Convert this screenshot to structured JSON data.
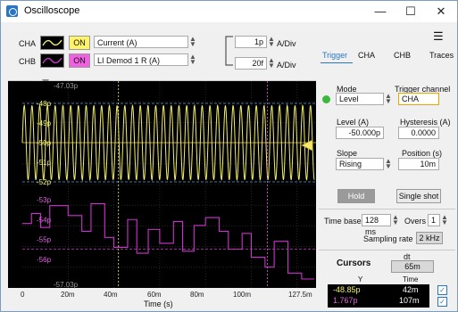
{
  "window": {
    "title": "Oscilloscope",
    "minimize": "—",
    "maximize": "☐",
    "close": "✕"
  },
  "channels": [
    {
      "label": "CHA",
      "on": "ON",
      "signal": "Current (A)",
      "color": "#f2ef6a",
      "on_color": "#fff36a"
    },
    {
      "label": "CHB",
      "on": "ON",
      "signal": "LI Demod 1 R (A)",
      "color": "#cc33cc",
      "on_color": "#f060e0"
    }
  ],
  "scale": [
    {
      "value": "1p",
      "unit": "A/Div"
    },
    {
      "value": "20f",
      "unit": "A/Div"
    }
  ],
  "plot": {
    "cha_labels": [
      "48p",
      "49p",
      "50p",
      "51p",
      "52p"
    ],
    "chb_labels": [
      "53p",
      "54p",
      "55p",
      "56p"
    ],
    "top_label": "-47.03p",
    "bottom_label": "-57.03p"
  },
  "xaxis": {
    "ticks": [
      "0",
      "20m",
      "40m",
      "60m",
      "80m",
      "100m",
      "127.5m"
    ],
    "label": "Time (s)"
  },
  "tabs": [
    "Trigger",
    "CHA",
    "CHB",
    "Traces"
  ],
  "trigger": {
    "mode_label": "Mode",
    "mode_value": "Level",
    "channel_label": "Trigger channel",
    "channel_value": "CHA",
    "level_label": "Level (A)",
    "level_value": "-50.000p",
    "hysteresis_label": "Hysteresis (A)",
    "hysteresis_value": "0.0000",
    "slope_label": "Slope",
    "slope_value": "Rising",
    "position_label": "Position (s)",
    "position_value": "10m",
    "hold": "Hold",
    "single_shot": "Single shot"
  },
  "timebase": {
    "label": "Time base",
    "value": "128 ms",
    "overs_label": "Overs",
    "overs_value": "1",
    "rate_label": "Sampling rate",
    "rate_value": "2 kHz"
  },
  "cursors": {
    "title": "Cursors",
    "dt_label": "dt",
    "dt_value": "65m",
    "col_y": "Y",
    "col_time": "Time",
    "rows": [
      {
        "y": "-48.85p",
        "time": "42m",
        "color": "#f2ef6a",
        "checked": "✓"
      },
      {
        "y": "1.767p",
        "time": "107m",
        "color": "#e060e0",
        "checked": "✓"
      }
    ]
  },
  "chart_data": {
    "type": "line",
    "xlabel": "Time (s)",
    "xlim": [
      0,
      0.1275
    ],
    "series": [
      {
        "name": "CHA",
        "color": "#f2ef6a",
        "ylim": [
          -52,
          -48
        ],
        "frequency_hz": 296,
        "amplitude": 1.9,
        "offset": -50
      },
      {
        "name": "CHB",
        "color": "#cc33cc",
        "ylim": [
          -57,
          -53
        ],
        "x": [
          0,
          0.004,
          0.004,
          0.008,
          0.008,
          0.012,
          0.012,
          0.02,
          0.02,
          0.026,
          0.026,
          0.03,
          0.03,
          0.036,
          0.036,
          0.04,
          0.04,
          0.046,
          0.046,
          0.05,
          0.05,
          0.055,
          0.055,
          0.06,
          0.06,
          0.066,
          0.066,
          0.07,
          0.07,
          0.075,
          0.075,
          0.08,
          0.08,
          0.086,
          0.086,
          0.09,
          0.09,
          0.096,
          0.096,
          0.1,
          0.1,
          0.106,
          0.106,
          0.11,
          0.11,
          0.116,
          0.116,
          0.122,
          0.122,
          0.1275
        ],
        "y": [
          -54.2,
          -54.2,
          -53.7,
          -53.7,
          -54.4,
          -54.4,
          -53.3,
          -53.3,
          -53.8,
          -53.8,
          -54.6,
          -54.6,
          -53.2,
          -53.2,
          -54.9,
          -54.9,
          -55.4,
          -55.4,
          -54.0,
          -54.0,
          -55.7,
          -55.7,
          -54.5,
          -54.5,
          -55.2,
          -55.2,
          -54.1,
          -54.1,
          -55.6,
          -55.6,
          -54.3,
          -54.3,
          -53.9,
          -53.9,
          -54.6,
          -54.6,
          -55.5,
          -55.5,
          -54.7,
          -54.7,
          -55.9,
          -55.9,
          -56.4,
          -56.4,
          -55.1,
          -55.1,
          -56.7,
          -56.7,
          -57.0,
          -57.0
        ]
      }
    ],
    "cursors_x": [
      0.042,
      0.107
    ],
    "grid": true
  }
}
